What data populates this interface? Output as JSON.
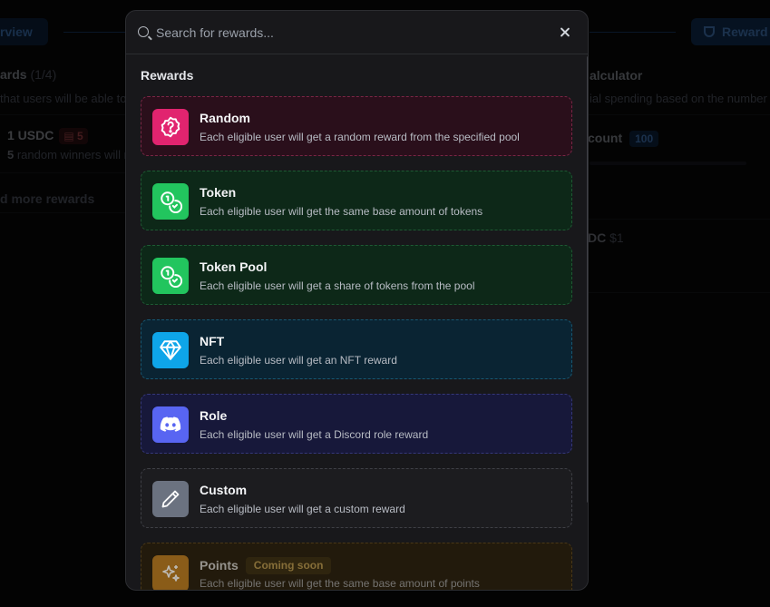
{
  "background": {
    "overview_tab": "rview",
    "rewards_button": "Reward",
    "rewards_heading": "ards",
    "rewards_count": "(1/4)",
    "rewards_sub": "that users will be able to",
    "reward_item_title": "1 USDC",
    "reward_item_badge": "5",
    "reward_item_winners_count": "5",
    "reward_item_winners_text": " random winners will r",
    "add_more": "d more rewards",
    "calculator_title": "alculator",
    "calculator_sub": "ial spending based on the number",
    "count_label": "count",
    "count_badge": "100",
    "dc_label": "DC",
    "dc_price": "$1"
  },
  "search": {
    "placeholder": "Search for rewards..."
  },
  "section_title": "Rewards",
  "rewards": [
    {
      "title": "Random",
      "desc": "Each eligible user will get a random reward from the specified pool",
      "icon": "random-icon"
    },
    {
      "title": "Token",
      "desc": "Each eligible user will get the same base amount of tokens",
      "icon": "coins-icon"
    },
    {
      "title": "Token Pool",
      "desc": "Each eligible user will get a share of tokens from the pool",
      "icon": "coins-icon"
    },
    {
      "title": "NFT",
      "desc": "Each eligible user will get an NFT reward",
      "icon": "diamond-icon"
    },
    {
      "title": "Role",
      "desc": "Each eligible user will get a Discord role reward",
      "icon": "discord-icon"
    },
    {
      "title": "Custom",
      "desc": "Each eligible user will get a custom reward",
      "icon": "pencil-icon"
    },
    {
      "title": "Points",
      "badge": "Coming soon",
      "desc": "Each eligible user will get the same base amount of points",
      "icon": "sparkles-icon"
    }
  ],
  "colors": {
    "random": "#e1246f",
    "token": "#22c55e",
    "nft": "#0ea5e9",
    "role": "#5865f2",
    "custom": "#6b7280",
    "points": "#b7791f"
  }
}
